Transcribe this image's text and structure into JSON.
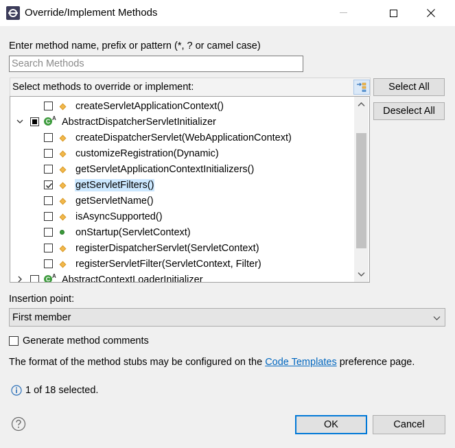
{
  "window": {
    "title": "Override/Implement Methods"
  },
  "search": {
    "prompt": "Enter method name, prefix or pattern (*, ? or camel case)",
    "placeholder": "Search Methods",
    "value": ""
  },
  "list": {
    "header": "Select methods to override or implement:",
    "rows": [
      {
        "label": "createServletApplicationContext()",
        "kind": "method-protected",
        "checked": false
      },
      {
        "label": "AbstractDispatcherServletInitializer",
        "kind": "class",
        "checked": "partial",
        "expanded": true
      },
      {
        "label": "createDispatcherServlet(WebApplicationContext)",
        "kind": "method-protected",
        "checked": false
      },
      {
        "label": "customizeRegistration(Dynamic)",
        "kind": "method-protected",
        "checked": false
      },
      {
        "label": "getServletApplicationContextInitializers()",
        "kind": "method-protected",
        "checked": false
      },
      {
        "label": "getServletFilters()",
        "kind": "method-protected",
        "checked": true,
        "selected": true
      },
      {
        "label": "getServletName()",
        "kind": "method-protected",
        "checked": false
      },
      {
        "label": "isAsyncSupported()",
        "kind": "method-protected",
        "checked": false
      },
      {
        "label": "onStartup(ServletContext)",
        "kind": "method-public",
        "checked": false
      },
      {
        "label": "registerDispatcherServlet(ServletContext)",
        "kind": "method-protected",
        "checked": false
      },
      {
        "label": "registerServletFilter(ServletContext, Filter)",
        "kind": "method-protected",
        "checked": false
      },
      {
        "label": "AbstractContextLoaderInitializer",
        "kind": "class",
        "checked": false,
        "expanded": false
      }
    ]
  },
  "buttons": {
    "select_all": "Select All",
    "deselect_all": "Deselect All",
    "ok": "OK",
    "cancel": "Cancel"
  },
  "insertion": {
    "label": "Insertion point:",
    "selected": "First member"
  },
  "generate_comments": {
    "label": "Generate method comments",
    "checked": false
  },
  "format": {
    "prefix": "The format of the method stubs may be configured on the ",
    "link": "Code Templates",
    "suffix": " preference page."
  },
  "status": {
    "text": "1 of 18 selected."
  },
  "icons": {
    "app": "eclipse-icon",
    "minimize": "minimize-icon",
    "maximize": "maximize-icon",
    "close": "close-icon",
    "sort": "sort-by-type-icon",
    "info": "info-icon",
    "help": "help-icon",
    "protected_method": "protected-method-icon",
    "public_method": "public-method-icon",
    "class": "abstract-class-icon"
  },
  "colors": {
    "accent": "#0078d7",
    "link": "#0066bf",
    "selection": "#cce8ff",
    "protected": "#f2b84b",
    "public": "#3a9a3a"
  }
}
